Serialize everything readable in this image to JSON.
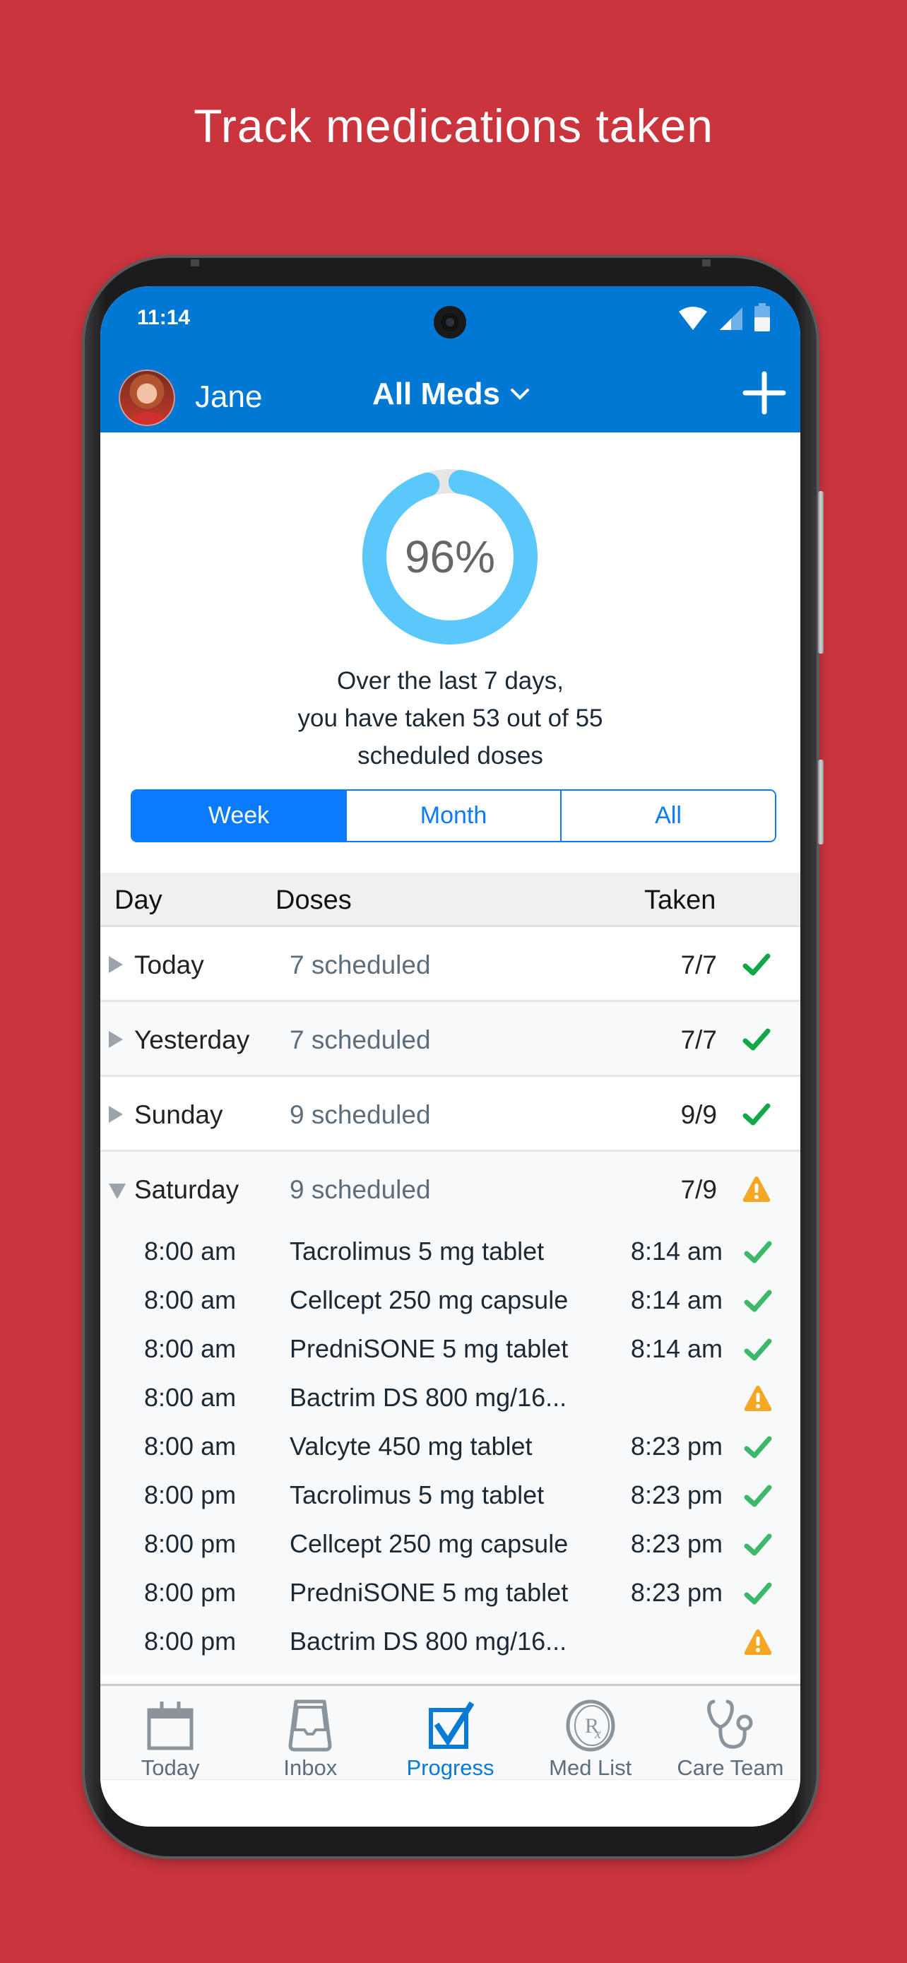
{
  "promo": {
    "title": "Track medications taken"
  },
  "status_bar": {
    "time": "11:14",
    "icons": [
      "wifi-icon",
      "cell-signal-icon",
      "battery-icon"
    ]
  },
  "header": {
    "user_name": "Jane",
    "med_filter": "All Meds",
    "add_icon": "plus-icon",
    "colors": {
      "bar": "#0078D4"
    }
  },
  "adherence": {
    "percent_label": "96%",
    "percent": 96,
    "taken": 53,
    "scheduled": 55,
    "summary_lines": [
      "Over the last 7 days,",
      "you have taken 53 out of 55",
      "scheduled doses"
    ],
    "colors": {
      "ring": "#5AC8FA",
      "track": "#E6E6E6"
    }
  },
  "range_tabs": [
    {
      "label": "Week",
      "active": true
    },
    {
      "label": "Month",
      "active": false
    },
    {
      "label": "All",
      "active": false
    }
  ],
  "table": {
    "headers": {
      "day": "Day",
      "doses": "Doses",
      "taken": "Taken"
    },
    "days": [
      {
        "day": "Today",
        "scheduled": "7 scheduled",
        "taken": "7/7",
        "status": "ok",
        "expanded": false
      },
      {
        "day": "Yesterday",
        "scheduled": "7 scheduled",
        "taken": "7/7",
        "status": "ok",
        "expanded": false
      },
      {
        "day": "Sunday",
        "scheduled": "9 scheduled",
        "taken": "9/9",
        "status": "ok",
        "expanded": false
      },
      {
        "day": "Saturday",
        "scheduled": "9 scheduled",
        "taken": "7/9",
        "status": "warning",
        "expanded": true
      }
    ],
    "saturday_doses": [
      {
        "time": "8:00 am",
        "med": "Tacrolimus 5 mg tablet",
        "taken_at": "8:14 am",
        "status": "ok"
      },
      {
        "time": "8:00 am",
        "med": "Cellcept 250 mg capsule",
        "taken_at": "8:14 am",
        "status": "ok"
      },
      {
        "time": "8:00 am",
        "med": "PredniSONE 5 mg tablet",
        "taken_at": "8:14 am",
        "status": "ok"
      },
      {
        "time": "8:00 am",
        "med": "Bactrim DS 800 mg/16...",
        "taken_at": "",
        "status": "warning"
      },
      {
        "time": "8:00 am",
        "med": "Valcyte 450 mg tablet",
        "taken_at": "8:23 pm",
        "status": "ok"
      },
      {
        "time": "8:00 pm",
        "med": "Tacrolimus 5 mg tablet",
        "taken_at": "8:23 pm",
        "status": "ok"
      },
      {
        "time": "8:00 pm",
        "med": "Cellcept 250 mg capsule",
        "taken_at": "8:23 pm",
        "status": "ok"
      },
      {
        "time": "8:00 pm",
        "med": "PredniSONE 5 mg tablet",
        "taken_at": "8:23 pm",
        "status": "ok"
      },
      {
        "time": "8:00 pm",
        "med": "Bactrim DS 800 mg/16...",
        "taken_at": "",
        "status": "warning"
      }
    ],
    "colors": {
      "ok": "#12A84A",
      "ok_light": "#3DB86A",
      "warning": "#F5A623"
    }
  },
  "tab_bar": {
    "items": [
      {
        "label": "Today",
        "icon": "calendar-icon",
        "active": false
      },
      {
        "label": "Inbox",
        "icon": "inbox-tray-icon",
        "active": false
      },
      {
        "label": "Progress",
        "icon": "checkbox-icon",
        "active": true
      },
      {
        "label": "Med List",
        "icon": "rx-pill-icon",
        "active": false
      },
      {
        "label": "Care Team",
        "icon": "stethoscope-icon",
        "active": false
      }
    ],
    "colors": {
      "active": "#0A7AD4",
      "inactive": "#8A949C"
    }
  }
}
